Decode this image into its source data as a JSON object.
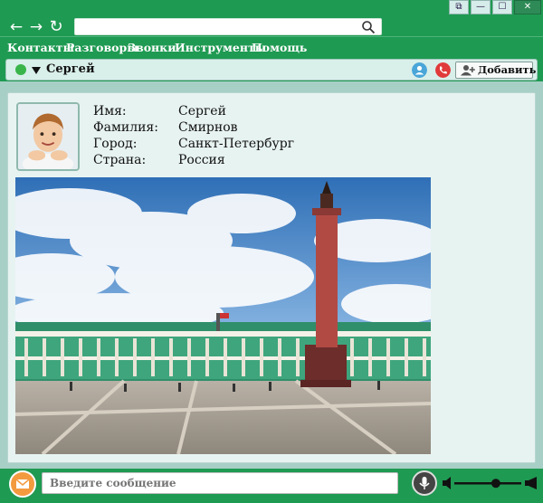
{
  "window": {
    "controls": [
      {
        "name": "restore",
        "glyph": "⧉"
      },
      {
        "name": "minimize",
        "glyph": "—"
      },
      {
        "name": "maximize",
        "glyph": "☐"
      },
      {
        "name": "close",
        "glyph": "✕"
      }
    ]
  },
  "toolbar": {
    "back_glyph": "←",
    "forward_glyph": "→",
    "refresh_glyph": "↻",
    "address_value": ""
  },
  "menu": [
    "Контакты",
    "Разговоры",
    "Звонки",
    "Инструменты",
    "Помощь"
  ],
  "contact": {
    "name": "Сергей",
    "status_color": "#39b54a",
    "add_label": "Добавить"
  },
  "profile": {
    "fields": [
      {
        "label": "Имя:",
        "value": "Сергей"
      },
      {
        "label": "Фамилия:",
        "value": "Смирнов"
      },
      {
        "label": "Город:",
        "value": "Санкт-Петербург"
      },
      {
        "label": "Страна:",
        "value": "Россия"
      }
    ]
  },
  "message": {
    "placeholder": "Введите сообщение"
  },
  "volume": {
    "level": 0.62
  },
  "colors": {
    "accent": "#1f9a52",
    "panel": "#e7f3f1",
    "call_red": "#e13a3a",
    "video_blue": "#4aa6d8",
    "mail_orange": "#f39a3f"
  }
}
